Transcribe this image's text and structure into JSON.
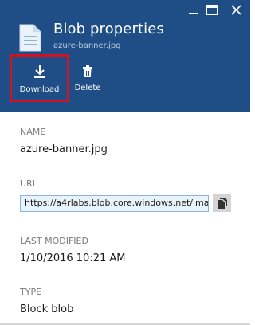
{
  "window": {
    "controls": [
      {
        "name": "minimize",
        "icon": "minimize-icon"
      },
      {
        "name": "maximize",
        "icon": "maximize-icon"
      },
      {
        "name": "close",
        "icon": "close-icon"
      }
    ]
  },
  "header": {
    "icon": "document-icon",
    "title": "Blob properties",
    "subtitle": "azure-banner.jpg",
    "background": "#1e4e85"
  },
  "toolbar": {
    "download_label": "Download",
    "download_icon": "download-icon",
    "delete_label": "Delete",
    "delete_icon": "trash-icon",
    "highlight_color": "#d4121f"
  },
  "properties": {
    "name": {
      "label": "NAME",
      "value": "azure-banner.jpg"
    },
    "url": {
      "label": "URL",
      "value": "https://a4rlabs.blob.core.windows.net/ima",
      "copy_icon": "copy-icon"
    },
    "last_modified": {
      "label": "LAST MODIFIED",
      "value": "1/10/2016 10:21 AM"
    },
    "type": {
      "label": "TYPE",
      "value": "Block blob"
    }
  }
}
